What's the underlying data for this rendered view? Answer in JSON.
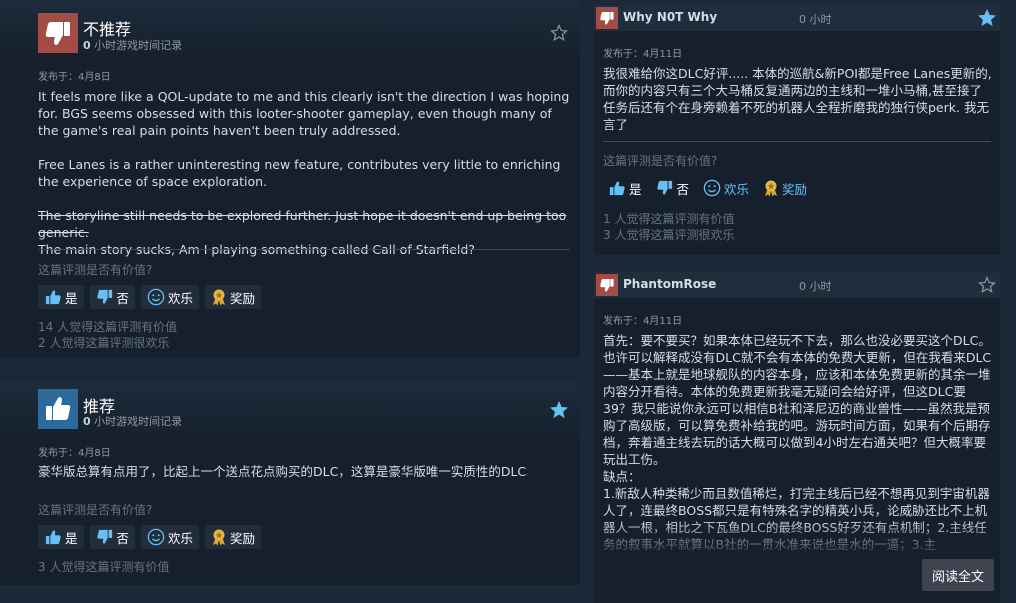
{
  "colors": {
    "accent": "#66c0f4",
    "not_recommended": "#a34c46",
    "recommended": "#2b6a9a",
    "background": "#1b2838"
  },
  "reviews": [
    {
      "verdict": "不推荐",
      "recommended": false,
      "hours": "0",
      "hours_label": "小时游戏时间记录",
      "posted": "发布于：4月8日",
      "paragraphs": [
        "It feels more like a QOL-update to me and this clearly isn't the direction I was hoping for. BGS seems obsessed with this looter-shooter gameplay, even though many of the game's real pain points haven't been truly addressed.",
        "Free Lanes is a rather uninteresting new feature, contributes very little to enriching the experience of space exploration."
      ],
      "strike_text": "The storyline still needs to be explored further. Just hope it doesn't end up being too generic.",
      "last_line": "The main story sucks, Am I playing something called Call of Starfield?",
      "helpful_question": "这篇评测是否有价值?",
      "buttons": {
        "yes": "是",
        "no": "否",
        "funny": "欢乐",
        "award": "奖励"
      },
      "stats": [
        "14 人觉得这篇评测有价值",
        "2 人觉得这篇评测很欢乐"
      ]
    },
    {
      "verdict": "推荐",
      "recommended": true,
      "hours": "0",
      "hours_label": "小时游戏时间记录",
      "posted": "发布于：4月8日",
      "text": "豪华版总算有点用了，比起上一个送点花点购买的DLC，这算是豪华版唯一实质性的DLC",
      "helpful_question": "这篇评测是否有价值?",
      "buttons": {
        "yes": "是",
        "no": "否",
        "funny": "欢乐",
        "award": "奖励"
      },
      "stats": [
        "3 人觉得这篇评测有价值"
      ]
    },
    {
      "author": "Why N0T Why",
      "hours": "0 小时",
      "posted": "发布于：4月11日",
      "text": "我很难给你这DLC好评..... 本体的巡航&新POI都是Free Lanes更新的,而你的内容只有三个大马桶反复通两边的主线和一堆小马桶,甚至接了任务后还有个在身旁赖着不死的机器人全程折磨我的独行侠perk. 我无言了",
      "helpful_question": "这篇评测是否有价值?",
      "buttons": {
        "yes": "是",
        "no": "否",
        "funny": "欢乐",
        "award": "奖励"
      },
      "stats": [
        "1 人觉得这篇评测有价值",
        "3 人觉得这篇评测很欢乐"
      ]
    },
    {
      "author": "PhantomRose",
      "hours": "0 小时",
      "posted": "发布于：4月11日",
      "text": "首先：要不要买？如果本体已经玩不下去，那么也没必要买这个DLC。也许可以解释成没有DLC就不会有本体的免费大更新，但在我看来DLC——基本上就是地球舰队的内容本身，应该和本体免费更新的其余一堆内容分开看待。本体的免费更新我毫无疑问会给好评，但这DLC要39？我只能说你永远可以相信B社和泽尼迈的商业兽性——虽然我是预购了高级版，可以算免费补给我的吧。游玩时间方面，如果有个后期存档，奔着通主线去玩的话大概可以做到4小时左右通关吧？但大概率要玩出工伤。",
      "text2": "缺点：",
      "text3": "1.新敌人种类稀少而且数值稀烂，打完主线后已经不想再见到宇宙机器人了，连最终BOSS都只是有特殊名字的精英小兵，论威胁还比不上机器人一根，相比之下瓦鱼DLC的最终BOSS好歹还有点机制；2.主线任务的叙事水平就算以B社的一贯水准来说也是水的一逼；3.主",
      "read_more": "阅读全文"
    }
  ]
}
